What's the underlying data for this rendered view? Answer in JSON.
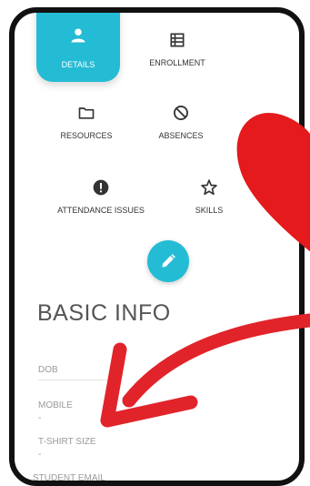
{
  "menu": {
    "details": {
      "label": "DETAILS",
      "icon": "person-icon"
    },
    "enrollment": {
      "label": "ENROLLMENT",
      "icon": "list-icon"
    },
    "resources": {
      "label": "RESOURCES",
      "icon": "folder-icon"
    },
    "absences": {
      "label": "ABSENCES",
      "icon": "block-icon"
    },
    "attendance_issues": {
      "label": "ATTENDANCE ISSUES",
      "icon": "alert-icon"
    },
    "skills": {
      "label": "SKILLS",
      "icon": "star-icon"
    }
  },
  "edit_button": {
    "icon": "pencil-icon"
  },
  "basic_info": {
    "title": "BASIC INFO",
    "fields": [
      {
        "label": "DOB",
        "value": ""
      },
      {
        "label": "MOBILE",
        "value": "-"
      },
      {
        "label": "T-SHIRT SIZE",
        "value": "-"
      },
      {
        "label": "STUDENT EMAIL",
        "value": ""
      }
    ]
  },
  "colors": {
    "accent": "#23bcd4",
    "heart": "#e41a1c",
    "arrow": "#e1242a",
    "frame": "#111111"
  },
  "decorations": {
    "heart": "heart-icon",
    "arrow": "arrow-icon"
  }
}
